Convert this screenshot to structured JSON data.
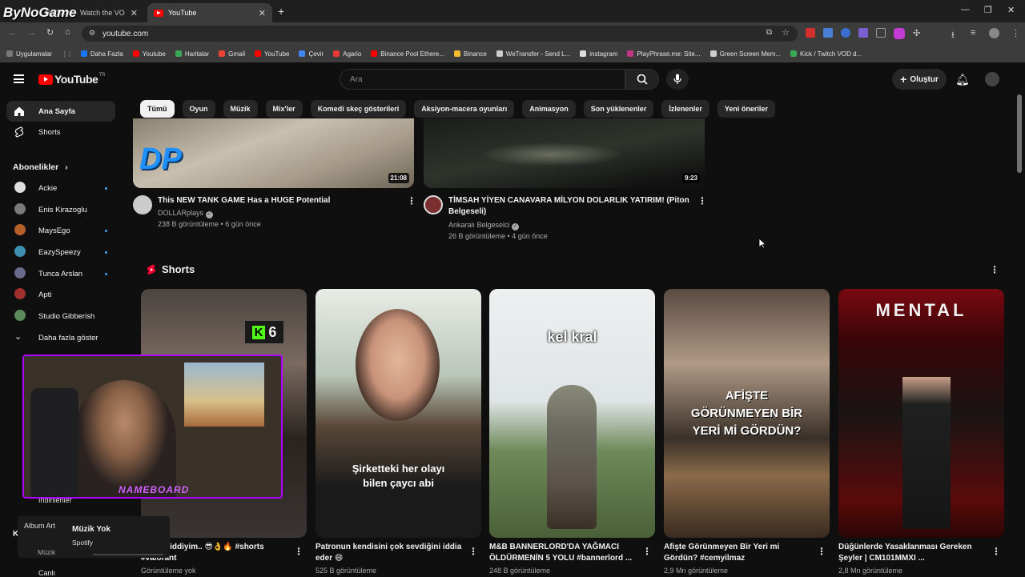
{
  "watermark": "ByNoGame",
  "browser": {
    "tabs": [
      {
        "label": "NoGame - Watch the VOD on..."
      },
      {
        "label": "YouTube"
      }
    ],
    "url": "youtube.com",
    "bookmarks": [
      "Uygulamalar",
      "Daha Fazla",
      "Youtube",
      "Haritalar",
      "Gmail",
      "YouTube",
      "Çevir",
      "Agario",
      "Binance Pool Ethere...",
      "Binance",
      "WeTransfer - Send L...",
      "instagram",
      "PlayPhrase.me: Site...",
      "Green Screen Mem...",
      "Kick / Twitch VOD d..."
    ]
  },
  "header": {
    "logo": "YouTube",
    "logo_suffix": "TR",
    "search_placeholder": "Ara",
    "create_label": "Oluştur"
  },
  "chips": [
    "Tümü",
    "Oyun",
    "Müzik",
    "Mix'ler",
    "Komedi skeç gösterileri",
    "Aksiyon-macera oyunları",
    "Animasyon",
    "Son yüklenenler",
    "İzlenenler",
    "Yeni öneriler"
  ],
  "sidebar": {
    "home": "Ana Sayfa",
    "shorts": "Shorts",
    "subs_heading": "Abonelikler",
    "subs": [
      "Ackie",
      "Enis Kirazoglu",
      "MaysEgo",
      "EazySpeezy",
      "Tunca Arslan",
      "Apti",
      "Studio Gibberish"
    ],
    "show_more": "Daha fazla göster",
    "partial_downloads": "İndirilenler",
    "partial_explore": "Keşfet",
    "partial_live": "Canlı"
  },
  "videos": [
    {
      "title": "This NEW TANK GAME Has a HUGE Potential",
      "channel": "DOLLARplays",
      "meta": "238 B görüntüleme • 6 gün önce",
      "duration": "21:08",
      "thumb_text": "DP"
    },
    {
      "title_line1": "TİMSAH YİYEN CANAVARA MİLYON DOLARLIK YATIRIM! (Piton",
      "title_line2": "Belgeseli)",
      "channel": "Ankaralı Belgeselci",
      "meta": "26 B görüntüleme • 4 gün önce",
      "duration": "9:23"
    }
  ],
  "shorts_heading": "Shorts",
  "shorts": [
    {
      "title_line1": "Gayet ciddiyim.. 😎👌🔥 #shorts",
      "title_line2": "#valorant",
      "meta": "Görüntüleme yok",
      "caption": "6"
    },
    {
      "title_line1": "Patronun kendisini çok sevdiğini iddia",
      "title_line2": "eder 😄",
      "meta": "525 B görüntüleme",
      "caption_line1": "Şirketteki her olayı",
      "caption_line2": "bilen çaycı abi"
    },
    {
      "title_line1": "M&B BANNERLORD'DA YAĞMACI",
      "title_line2": "ÖLDÜRMENİN 5 YOLU #bannerlord ...",
      "meta": "248 B görüntüleme",
      "caption": "kel kral"
    },
    {
      "title_line1": "Afişte Görünmeyen Bir Yeri mi",
      "title_line2": "Gördün? #cemyilmaz",
      "meta": "2,9 Mn görüntüleme",
      "caption_line1": "AFİŞTE",
      "caption_line2": "GÖRÜNMEYEN BİR",
      "caption_line3": "YERİ Mİ GÖRDÜN?"
    },
    {
      "title_line1": "Düğünlerde Yasaklanması Gereken",
      "title_line2": "Şeyler | CM101MMXI ...",
      "meta": "2,8 Mn görüntüleme",
      "caption": "MENTAL"
    }
  ],
  "spotify": {
    "album_label": "Album Art",
    "track": "Müzik Yok",
    "source": "Spotify",
    "category": "Müzik"
  },
  "webcam_overlay": "NAMEBOARD"
}
